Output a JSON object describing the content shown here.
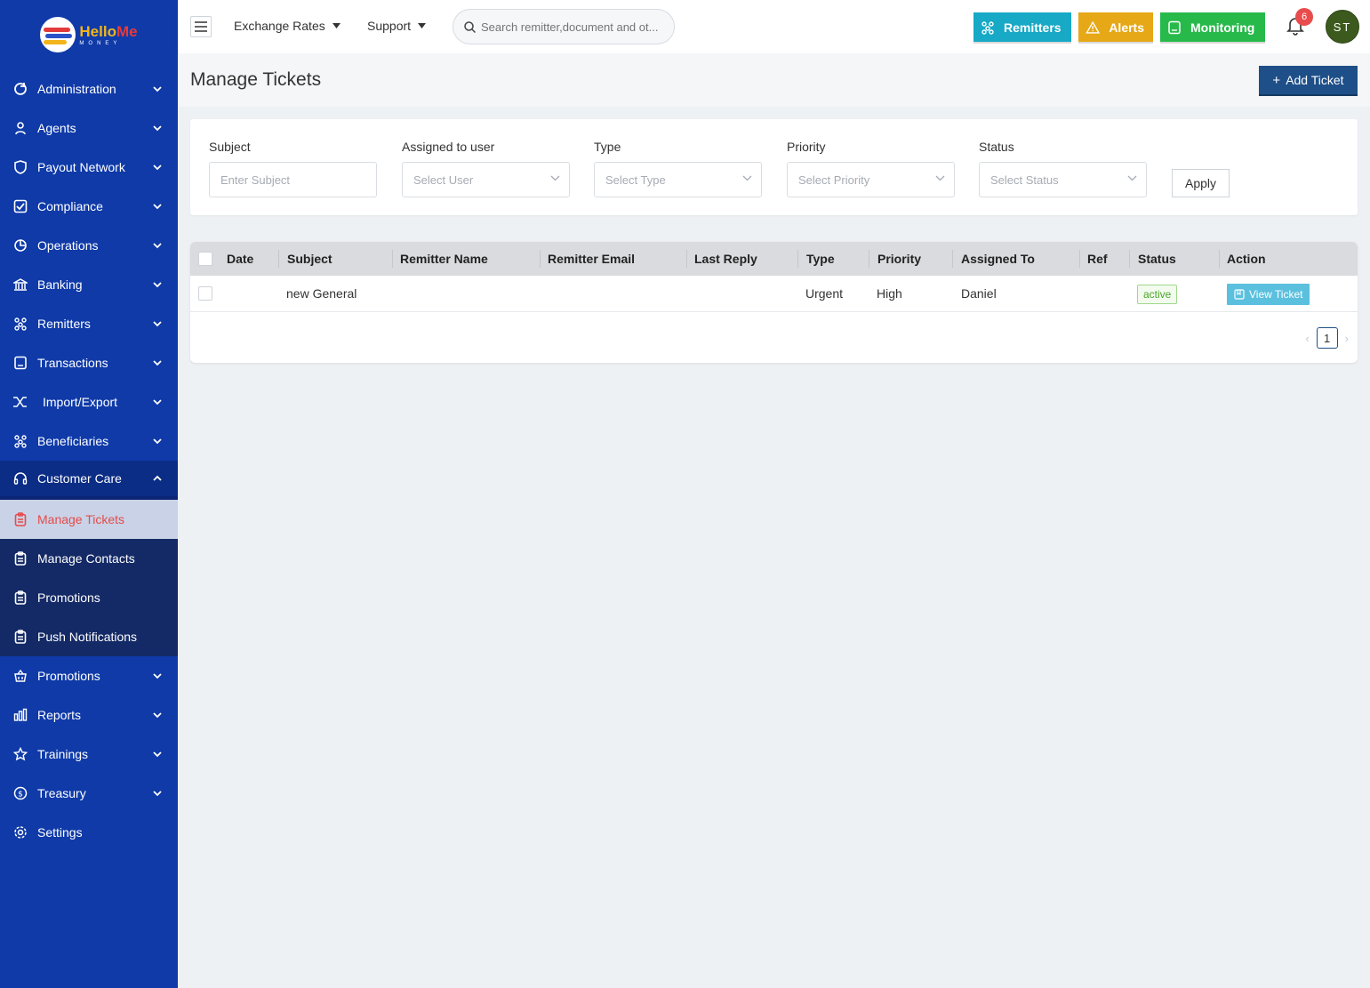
{
  "brand": {
    "word_part1": "Hello",
    "word_part2": "Me",
    "sub": "MONEY"
  },
  "sidebar": {
    "items": [
      {
        "label": "Administration"
      },
      {
        "label": "Agents"
      },
      {
        "label": "Payout Network"
      },
      {
        "label": "Compliance"
      },
      {
        "label": "Operations"
      },
      {
        "label": "Banking"
      },
      {
        "label": "Remitters"
      },
      {
        "label": "Transactions"
      },
      {
        "label": "Import/Export"
      },
      {
        "label": "Beneficiaries"
      },
      {
        "label": "Customer Care"
      }
    ],
    "customer_care_sub": [
      {
        "label": "Manage Tickets"
      },
      {
        "label": "Manage Contacts"
      },
      {
        "label": "Promotions"
      },
      {
        "label": "Push Notifications"
      }
    ],
    "items_after": [
      {
        "label": "Promotions"
      },
      {
        "label": "Reports"
      },
      {
        "label": "Trainings"
      },
      {
        "label": "Treasury"
      },
      {
        "label": "Settings"
      }
    ]
  },
  "topbar": {
    "exchange_rates": "Exchange Rates",
    "support": "Support",
    "search_placeholder": "Search remitter,document and ot...",
    "remitters_btn": "Remitters",
    "alerts_btn": "Alerts",
    "monitoring_btn": "Monitoring",
    "notification_count": "6",
    "avatar_initials": "ST",
    "colors": {
      "remitters": "#17a9c6",
      "alerts": "#e6a817",
      "monitoring": "#28b94b"
    }
  },
  "page": {
    "title": "Manage Tickets",
    "add_ticket": "Add Ticket"
  },
  "filters": {
    "subject_label": "Subject",
    "subject_placeholder": "Enter Subject",
    "user_label": "Assigned to user",
    "user_placeholder": "Select User",
    "type_label": "Type",
    "type_placeholder": "Select Type",
    "priority_label": "Priority",
    "priority_placeholder": "Select Priority",
    "status_label": "Status",
    "status_placeholder": "Select Status",
    "apply": "Apply"
  },
  "table": {
    "headers": [
      "Date",
      "Subject",
      "Remitter Name",
      "Remitter Email",
      "Last Reply",
      "Type",
      "Priority",
      "Assigned To",
      "Ref",
      "Status",
      "Action"
    ],
    "rows": [
      {
        "date": "",
        "subject": "new General",
        "remitter_name": "",
        "remitter_email": "",
        "last_reply": "",
        "type": "Urgent",
        "priority": "High",
        "assigned_to": "Daniel",
        "ref": "",
        "status": "active",
        "action": "View Ticket"
      }
    ],
    "current_page": "1"
  }
}
